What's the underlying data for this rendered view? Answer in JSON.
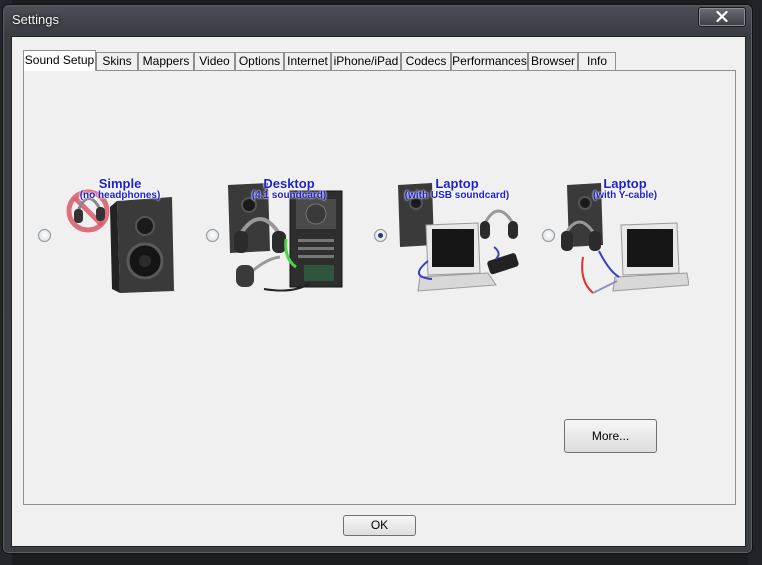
{
  "window": {
    "title": "Settings"
  },
  "tabs": [
    {
      "label": "Sound Setup",
      "active": true
    },
    {
      "label": "Skins"
    },
    {
      "label": "Mappers"
    },
    {
      "label": "Video"
    },
    {
      "label": "Options"
    },
    {
      "label": "Internet"
    },
    {
      "label": "iPhone/iPad"
    },
    {
      "label": "Codecs"
    },
    {
      "label": "Performances"
    },
    {
      "label": "Browser"
    },
    {
      "label": "Info"
    }
  ],
  "sound_setup": {
    "options": [
      {
        "title": "Simple",
        "subtitle": "(no headphones)",
        "selected": false
      },
      {
        "title": "Desktop",
        "subtitle": "(4.1 soundcard)",
        "selected": false
      },
      {
        "title": "Laptop",
        "subtitle": "(with USB soundcard)",
        "selected": true
      },
      {
        "title": "Laptop",
        "subtitle": "(with Y-cable)",
        "selected": false
      }
    ],
    "more_label": "More..."
  },
  "ok_label": "OK",
  "colors": {
    "option_text": "#1b1fd6",
    "window_frame": "#3b3e43"
  },
  "icons": [
    "close-icon",
    "speaker-icon",
    "headphones-icon",
    "no-headphones-icon",
    "pc-tower-icon",
    "laptop-icon",
    "usb-soundcard-icon",
    "y-cable-icon"
  ]
}
